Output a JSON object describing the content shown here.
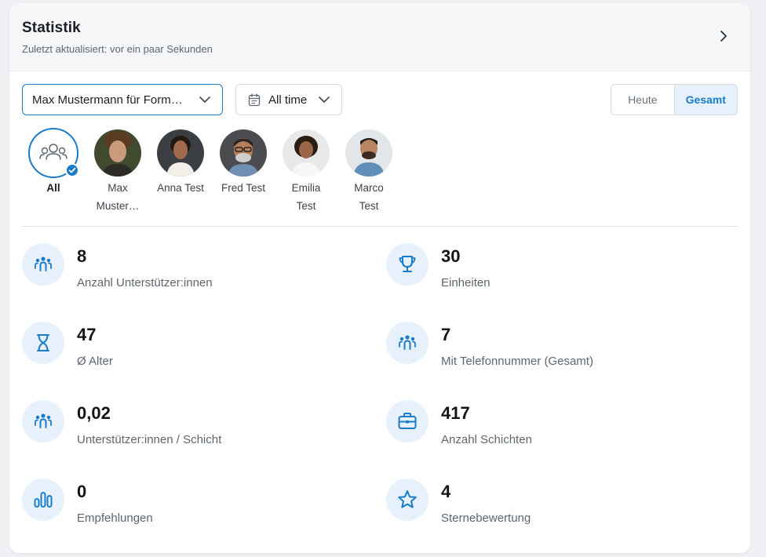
{
  "header": {
    "title": "Statistik",
    "subtitle": "Zuletzt aktualisiert: vor ein paar Sekunden",
    "chevron_icon": "chevron-right-icon"
  },
  "filters": {
    "person_select": {
      "value": "Max Mustermann für Form…",
      "icon": "chevron-down-icon"
    },
    "time_select": {
      "value": "All time",
      "icon": "calendar-icon"
    },
    "segment": {
      "options": [
        "Heute",
        "Gesamt"
      ],
      "selected": "Gesamt"
    }
  },
  "avatars": [
    {
      "name": "All",
      "line2": "",
      "selected": true,
      "icon": "group-icon"
    },
    {
      "name": "Max",
      "line2": "Muster…",
      "selected": false
    },
    {
      "name": "Anna Test",
      "line2": "",
      "selected": false
    },
    {
      "name": "Fred Test",
      "line2": "",
      "selected": false
    },
    {
      "name": "Emilia",
      "line2": "Test",
      "selected": false
    },
    {
      "name": "Marco",
      "line2": "Test",
      "selected": false
    }
  ],
  "stats": [
    {
      "value": "8",
      "label": "Anzahl Unterstützer:innen",
      "icon": "people-icon"
    },
    {
      "value": "30",
      "label": "Einheiten",
      "icon": "trophy-icon"
    },
    {
      "value": "47",
      "label": "Ø Alter",
      "icon": "hourglass-icon"
    },
    {
      "value": "7",
      "label": "Mit Telefonnummer (Gesamt)",
      "icon": "people-icon"
    },
    {
      "value": "0,02",
      "label": "Unterstützer:innen / Schicht",
      "icon": "people-icon"
    },
    {
      "value": "417",
      "label": "Anzahl Schichten",
      "icon": "briefcase-icon"
    },
    {
      "value": "0",
      "label": "Empfehlungen",
      "icon": "bar-chart-icon"
    },
    {
      "value": "4",
      "label": "Sternebewertung",
      "icon": "star-icon"
    }
  ],
  "colors": {
    "accent": "#1a7bc6",
    "icon_bg": "#e6f1fb",
    "header_bg": "#f5f7f9"
  }
}
